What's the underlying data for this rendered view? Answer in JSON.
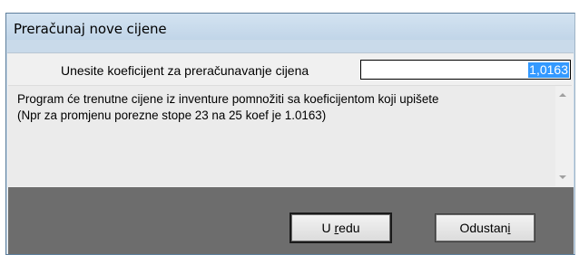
{
  "window": {
    "title": "Preračunaj nove cijene"
  },
  "form": {
    "prompt_label": "Unesite koeficijent za preračunavanje cijena",
    "coefficient_value": "1,0163"
  },
  "info": {
    "line1": "Program će trenutne cijene iz inventure pomnožiti sa koeficijentom koji upišete",
    "line2": "(Npr za promjenu porezne stope 23 na 25 koef je 1.0163)"
  },
  "buttons": {
    "ok": {
      "prefix": "U ",
      "accel": "r",
      "suffix": "edu"
    },
    "cancel": {
      "prefix": "Odustan",
      "accel": "i",
      "suffix": ""
    }
  }
}
